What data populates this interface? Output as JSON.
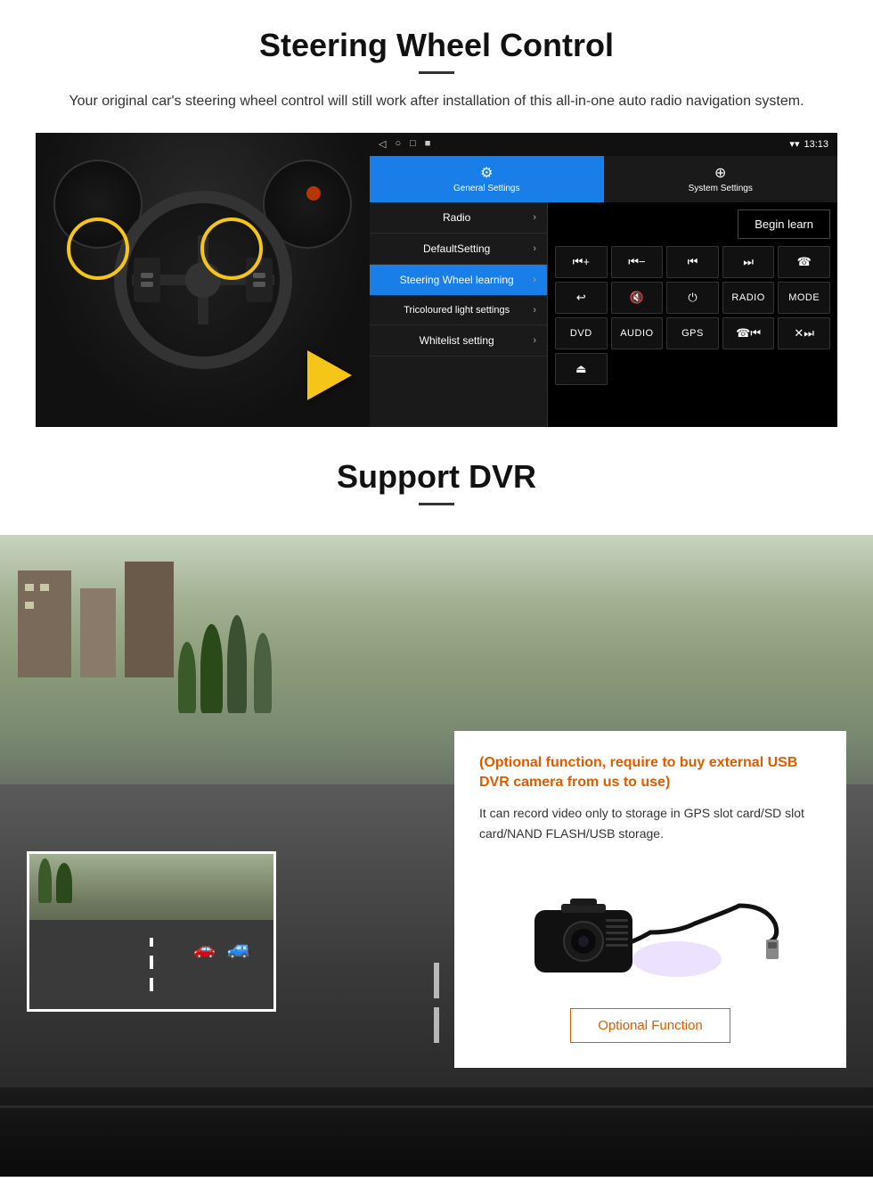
{
  "section1": {
    "title": "Steering Wheel Control",
    "description": "Your original car's steering wheel control will still work after installation of this all-in-one auto radio navigation system.",
    "android": {
      "status_bar": {
        "back": "◁",
        "home": "○",
        "recent": "□",
        "cast": "■",
        "time": "13:13"
      },
      "tabs": {
        "general": {
          "icon": "⚙",
          "label": "General Settings"
        },
        "system": {
          "icon": "⊕",
          "label": "System Settings"
        }
      },
      "menu_items": [
        {
          "label": "Radio",
          "active": false
        },
        {
          "label": "DefaultSetting",
          "active": false
        },
        {
          "label": "Steering Wheel learning",
          "active": true
        },
        {
          "label": "Tricoloured light settings",
          "active": false
        },
        {
          "label": "Whitelist setting",
          "active": false
        }
      ],
      "begin_learn": "Begin learn",
      "control_buttons": [
        {
          "label": "◀|+",
          "row": 1
        },
        {
          "label": "◀|−",
          "row": 1
        },
        {
          "label": "⏮",
          "row": 1
        },
        {
          "label": "⏭",
          "row": 1
        },
        {
          "label": "☎",
          "row": 1
        },
        {
          "label": "↩",
          "row": 2
        },
        {
          "label": "◀|✕",
          "row": 2
        },
        {
          "label": "⏻",
          "row": 2
        },
        {
          "label": "RADIO",
          "row": 2
        },
        {
          "label": "MODE",
          "row": 2
        },
        {
          "label": "DVD",
          "row": 3
        },
        {
          "label": "AUDIO",
          "row": 3
        },
        {
          "label": "GPS",
          "row": 3
        },
        {
          "label": "☎⏮",
          "row": 3
        },
        {
          "label": "✕⏭",
          "row": 3
        },
        {
          "label": "⏏",
          "row": 4
        }
      ]
    }
  },
  "section2": {
    "title": "Support DVR",
    "info_card": {
      "title": "(Optional function, require to buy external USB DVR camera from us to use)",
      "description": "It can record video only to storage in GPS slot card/SD slot card/NAND FLASH/USB storage.",
      "optional_button": "Optional Function"
    }
  }
}
